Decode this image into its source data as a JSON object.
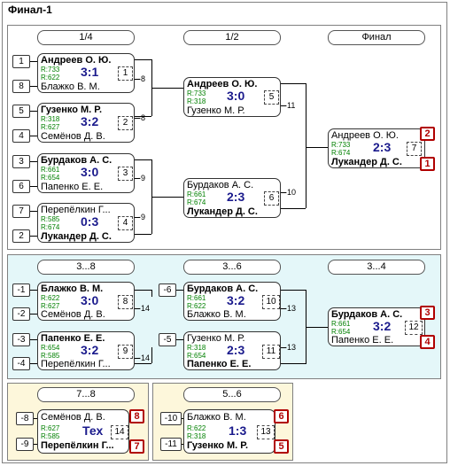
{
  "title": "Финал-1",
  "headers": {
    "r1": "1/4",
    "r2": "1/2",
    "r3": "Финал",
    "c1": "3...8",
    "c2": "3...6",
    "c3": "3...4",
    "d1": "7...8",
    "d2": "5...6"
  },
  "matches": {
    "m1": {
      "p1": "Андреев О. Ю.",
      "r1": "R:733",
      "p2": "Блажко В. М.",
      "r2": "R:622",
      "score": "3:1",
      "num": "1",
      "loser": "-8",
      "seed1": "1",
      "seed2": "8"
    },
    "m2": {
      "p1": "Гузенко М. Р.",
      "r1": "R:318",
      "p2": "Семёнов Д. В.",
      "r2": "R:627",
      "score": "3:2",
      "num": "2",
      "loser": "-8",
      "seed1": "5",
      "seed2": "4"
    },
    "m3": {
      "p1": "Бурдаков А. С.",
      "r1": "R:661",
      "p2": "Папенко Е. Е.",
      "r2": "R:654",
      "score": "3:0",
      "num": "3",
      "loser": "-9",
      "seed1": "3",
      "seed2": "6"
    },
    "m4": {
      "p1": "Перепёлкин Г...",
      "r1": "R:585",
      "p2": "Лукандер Д. С.",
      "r2": "R:674",
      "score": "0:3",
      "num": "4",
      "loser": "-9",
      "seed1": "7",
      "seed2": "2"
    },
    "m5": {
      "p1": "Андреев О. Ю.",
      "r1": "R:733",
      "p2": "Гузенко М. Р.",
      "r2": "R:318",
      "score": "3:0",
      "num": "5",
      "loser": "-11"
    },
    "m6": {
      "p1": "Бурдаков А. С.",
      "r1": "R:661",
      "p2": "Лукандер Д. С.",
      "r2": "R:674",
      "score": "2:3",
      "num": "6",
      "loser": "-10"
    },
    "m7": {
      "p1": "Андреев О. Ю.",
      "r1": "R:733",
      "p2": "Лукандер Д. С.",
      "r2": "R:674",
      "score": "2:3",
      "num": "7",
      "place1": "2",
      "place2": "1"
    },
    "m8": {
      "p1": "Блажко В. М.",
      "r1": "R:622",
      "p2": "Семёнов Д. В.",
      "r2": "R:627",
      "score": "3:0",
      "num": "8",
      "loser": "-14",
      "seed1": "-1",
      "seed2": "-2"
    },
    "m9": {
      "p1": "Папенко Е. Е.",
      "r1": "R:654",
      "p2": "Перепёлкин Г...",
      "r2": "R:585",
      "score": "3:2",
      "num": "9",
      "loser": "-14",
      "seed1": "-3",
      "seed2": "-4"
    },
    "m10": {
      "p1": "Бурдаков А. С.",
      "r1": "R:661",
      "p2": "Блажко В. М.",
      "r2": "R:622",
      "score": "3:2",
      "num": "10",
      "loser": "-13",
      "seed1": "-6"
    },
    "m11": {
      "p1": "Гузенко М. Р.",
      "r1": "R:318",
      "p2": "Папенко Е. Е.",
      "r2": "R:654",
      "score": "2:3",
      "num": "11",
      "loser": "-13",
      "seed1": "-5"
    },
    "m12": {
      "p1": "Бурдаков А. С.",
      "r1": "R:661",
      "p2": "Папенко Е. Е.",
      "r2": "R:654",
      "score": "3:2",
      "num": "12",
      "place1": "3",
      "place2": "4"
    },
    "m14": {
      "p1": "Семёнов Д. В.",
      "r1": "R:627",
      "p2": "Перепёлкин Г...",
      "r2": "R:585",
      "score": "Тех",
      "num": "14",
      "seed1": "-8",
      "seed2": "-9",
      "place1": "8",
      "place2": "7"
    },
    "m13": {
      "p1": "Блажко В. М.",
      "r1": "R:622",
      "p2": "Гузенко М. Р.",
      "r2": "R:318",
      "score": "1:3",
      "num": "13",
      "seed1": "-10",
      "seed2": "-11",
      "place1": "6",
      "place2": "5"
    }
  }
}
